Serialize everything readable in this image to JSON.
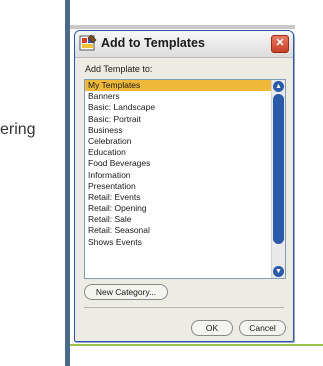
{
  "background": {
    "left_text": "ering"
  },
  "dialog": {
    "title": "Add to Templates",
    "icon": "templates-app-icon",
    "close_icon": "close-icon",
    "prompt": "Add Template to:",
    "items": [
      "My Templates",
      "Banners",
      "Basic: Landscape",
      "Basic: Portrait",
      "Business",
      "Celebration",
      "Education",
      "Food  Beverages",
      "Information",
      "Presentation",
      "Retail: Events",
      "Retail: Opening",
      "Retail: Sale",
      "Retail: Seasonal",
      "Shows  Events"
    ],
    "selected_index": 0,
    "scroll": {
      "position": 0,
      "visible_fraction": 0.88
    },
    "new_category_label": "New Category...",
    "ok_label": "OK",
    "cancel_label": "Cancel"
  },
  "colors": {
    "selection": "#f0b838",
    "scroll_blue": "#2a5aa8",
    "title_close": "#d4503a",
    "accent_line": "#9cc24a"
  }
}
